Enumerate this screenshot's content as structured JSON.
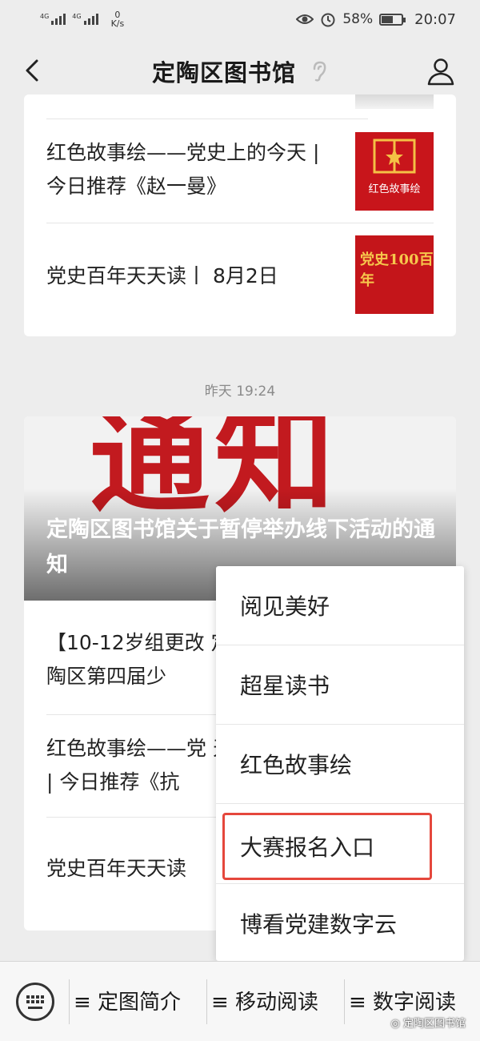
{
  "status_bar": {
    "net_tag_1": "4G",
    "net_tag_2": "4G",
    "speed_value": "0",
    "speed_unit": "K/s",
    "battery_percent": "58%",
    "battery_level": 0.58,
    "time": "20:07",
    "icons": [
      "eye-icon",
      "alarm-icon",
      "battery-icon"
    ]
  },
  "nav": {
    "title": "定陶区图书馆",
    "icons": [
      "back-arrow-icon",
      "ear-icon",
      "person-icon"
    ]
  },
  "feed_group_1": {
    "articles": [
      {
        "text": "红色故事绘——党史上的今天 | 今日推荐《赵一曼》",
        "thumb_text": "红色故事绘"
      },
      {
        "text": "党史百年天天读丨 8月2日",
        "thumb_text": "党史100百年"
      }
    ]
  },
  "timestamp": "昨天 19:24",
  "feed_group_2": {
    "cover_text": "通知",
    "cover_title": "定陶区图书馆关于暂停举办线下活动的通知",
    "articles": [
      {
        "text": "【10-12岁组更改 定陶区第四届少"
      },
      {
        "text": "红色故事绘——党 天 | 今日推荐《抗"
      },
      {
        "text": "党史百年天天读"
      }
    ]
  },
  "popup_menu": {
    "items": [
      "阅见美好",
      "超星读书",
      "红色故事绘",
      "大赛报名入口",
      "博看党建数字云"
    ],
    "highlighted": "大赛报名入口",
    "highlight_color": "#e5473c"
  },
  "bottom_bar": {
    "tabs": [
      "≡ 定图简介",
      "≡ 移动阅读",
      "≡ 数字阅读"
    ],
    "watermark": "定陶区图书馆",
    "icons": [
      "keyboard-icon"
    ]
  },
  "colors": {
    "red": "#c8151b",
    "background": "#ededed"
  }
}
